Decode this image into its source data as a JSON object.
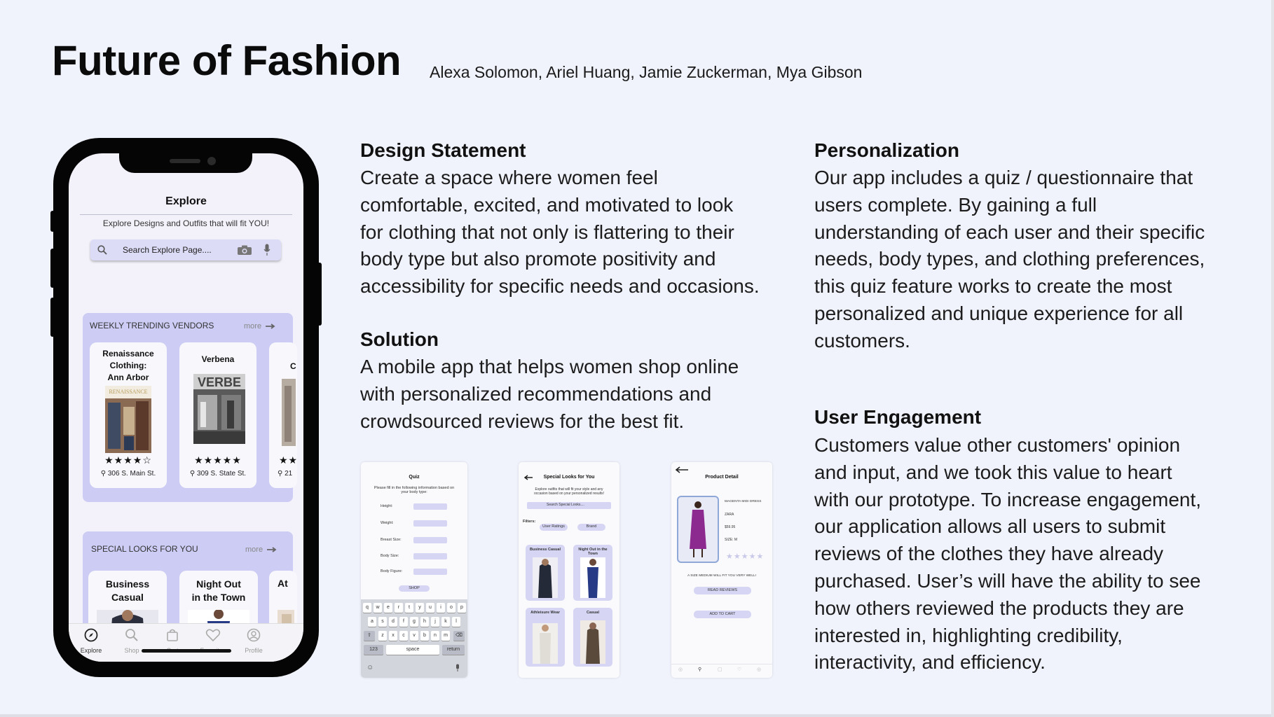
{
  "title": "Future of Fashion",
  "authors": "Alexa Solomon, Ariel Huang, Jamie Zuckerman, Mya Gibson",
  "sections": {
    "design_statement": {
      "title": "Design Statement",
      "lines": [
        "Create a space where women feel",
        "comfortable, excited, and motivated to look",
        "for clothing that not only is flattering to their",
        "body type but also promote positivity and",
        "accessibility for specific needs and occasions."
      ]
    },
    "solution": {
      "title": "Solution",
      "lines": [
        "A mobile app that helps women shop online",
        "with personalized recommendations and",
        "crowdsourced reviews for the best fit."
      ]
    },
    "personalization": {
      "title": "Personalization",
      "lines": [
        "Our app includes a quiz / questionnaire that",
        "users complete. By gaining a full",
        "understanding of each user and their specific",
        "needs, body types, and clothing preferences,",
        "this quiz feature works to create the most",
        "personalized and unique experience for all",
        "customers."
      ]
    },
    "user_engagement": {
      "title": "User Engagement",
      "lines": [
        "Customers value other customers' opinion",
        "and input, and we took this value to heart",
        "with our prototype. To increase engagement,",
        "our application allows all users to submit",
        "reviews of the clothes they have already",
        "purchased. User’s will have the ability to see",
        "how others reviewed the products they are",
        "interested in, highlighting credibility,",
        "interactivity, and efficiency."
      ]
    }
  },
  "phone": {
    "title": "Explore",
    "subtitle": "Explore Designs and Outfits that will fit YOU!",
    "search_placeholder": "Search Explore Page....",
    "vendors_panel": {
      "title": "WEEKLY TRENDING VENDORS",
      "more": "more",
      "cards": [
        {
          "name_lines": [
            "Renaissance",
            "Clothing:",
            "Ann Arbor"
          ],
          "stars": "★★★★☆",
          "address": "306 S. Main St."
        },
        {
          "name_lines": [
            "Verbena"
          ],
          "stars": "★★★★★",
          "address": "309 S. State St."
        },
        {
          "name_lines": [
            "C"
          ],
          "stars": "★★",
          "address": "21"
        }
      ]
    },
    "looks_panel": {
      "title": "SPECIAL LOOKS FOR YOU",
      "more": "more",
      "cards": [
        {
          "name_lines": [
            "Business",
            "Casual"
          ]
        },
        {
          "name_lines": [
            "Night Out",
            "in the Town"
          ]
        },
        {
          "name_lines": [
            "At"
          ]
        }
      ]
    },
    "tabs": [
      "Explore",
      "Shop",
      "Cart",
      "Favorites",
      "Profile"
    ]
  },
  "quiz_screen": {
    "title": "Quiz",
    "intro": "Please fill in the following information based on your body type:",
    "fields": [
      "Height:",
      "Weight:",
      "Breast Size:",
      "Body Size:",
      "Body Figure:"
    ],
    "button": "SHOP",
    "keyboard_rows": [
      [
        "q",
        "w",
        "e",
        "r",
        "t",
        "y",
        "u",
        "i",
        "o",
        "p"
      ],
      [
        "a",
        "s",
        "d",
        "f",
        "g",
        "h",
        "j",
        "k",
        "l"
      ],
      [
        "z",
        "x",
        "c",
        "v",
        "b",
        "n",
        "m"
      ]
    ],
    "space": "space",
    "return": "return",
    "num": "123"
  },
  "looks_screen": {
    "title": "Special Looks for You",
    "intro": "Explore outfits that will fit your style and any occasion based on your personalized results!",
    "search": "Search Special Looks....",
    "filters_label": "Filters:",
    "filters": [
      "User Ratings",
      "Brand"
    ],
    "cards": [
      "Business Casual",
      "Night Out in the Town",
      "Athleisure Wear",
      "Casual"
    ]
  },
  "product_screen": {
    "title": "Product Detail",
    "details": [
      "MAGENTA MIDI DRESS",
      "ZARA",
      "$59.95",
      "SIZE: M"
    ],
    "review": "A SIZE MEDIUM WILL FIT YOU VERY WELL!",
    "read_reviews": "READ REVIEWS",
    "add_to_cart": "ADD TO CART"
  },
  "colors": {
    "background": "#f0f2fc",
    "accent": "#ccccf4",
    "phone_frame": "#050505"
  }
}
